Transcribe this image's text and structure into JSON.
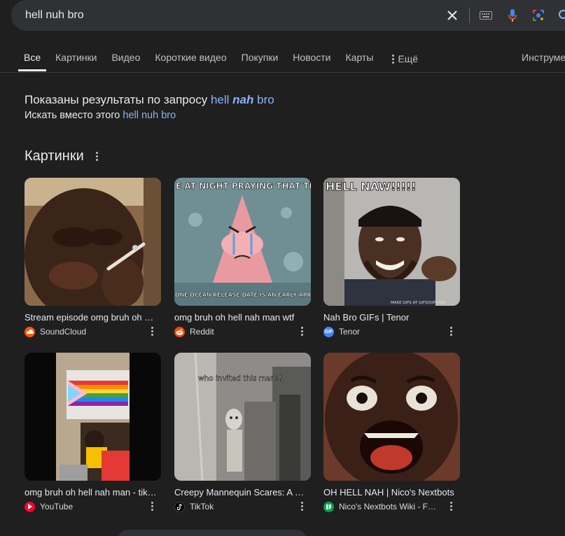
{
  "search": {
    "query": "hell nuh bro"
  },
  "tabs": [
    {
      "label": "Все",
      "active": true
    },
    {
      "label": "Картинки"
    },
    {
      "label": "Видео"
    },
    {
      "label": "Короткие видео"
    },
    {
      "label": "Покупки"
    },
    {
      "label": "Новости"
    },
    {
      "label": "Карты"
    }
  ],
  "more_label": "Ещё",
  "tools_label": "Инструменты",
  "spelling": {
    "prefix": "Показаны результаты по запросу",
    "corrected_1": "hell",
    "corrected_bold": "nah",
    "corrected_2": "bro",
    "instead_prefix": "Искать вместо этого",
    "original": "hell nuh bro"
  },
  "images_section": {
    "title": "Картинки",
    "items": [
      {
        "caption": "Stream episode omg bruh oh hell nah man",
        "source": "SoundCloud",
        "favicon_color": "#ff5500",
        "icon": "cloud-icon"
      },
      {
        "caption": "omg bruh oh hell nah man wtf",
        "source": "Reddit",
        "favicon_color": "#ff4500",
        "icon": "reddit-icon"
      },
      {
        "caption": "Nah Bro GIFs | Tenor",
        "source": "Tenor",
        "favicon_color": "#4285f4",
        "icon": "gif-icon"
      },
      {
        "caption": "omg bruh oh hell nah man - tiktok",
        "source": "YouTube",
        "favicon_color": "#ff0033",
        "icon": "play-icon"
      },
      {
        "caption": "Creepy Mannequin Scares: A Collection",
        "source": "TikTok",
        "favicon_color": "#010101",
        "icon": "note-icon"
      },
      {
        "caption": "OH HELL NAH | Nico's Nextbots",
        "source": "Nico's Nextbots Wiki - Fandom",
        "favicon_color": "#00a650",
        "icon": "fandom-icon"
      }
    ],
    "meme_texts": {
      "patrick_top": "E AT NIGHT PRAYING THAT THE N",
      "patrick_bottom": "ONE OCEAN RELEASE DATE IS AN EARLY APRIL FOOLS",
      "tenor_top": "HELL NAW!!!!!",
      "tenor_watermark": "MAKE GIFS AT GIFSOUP.COM",
      "mannequin_top": "who invited this man?!"
    }
  },
  "colors": {
    "background": "#1f1f1f",
    "link": "#8ab4f8",
    "searchbar": "#303134"
  }
}
